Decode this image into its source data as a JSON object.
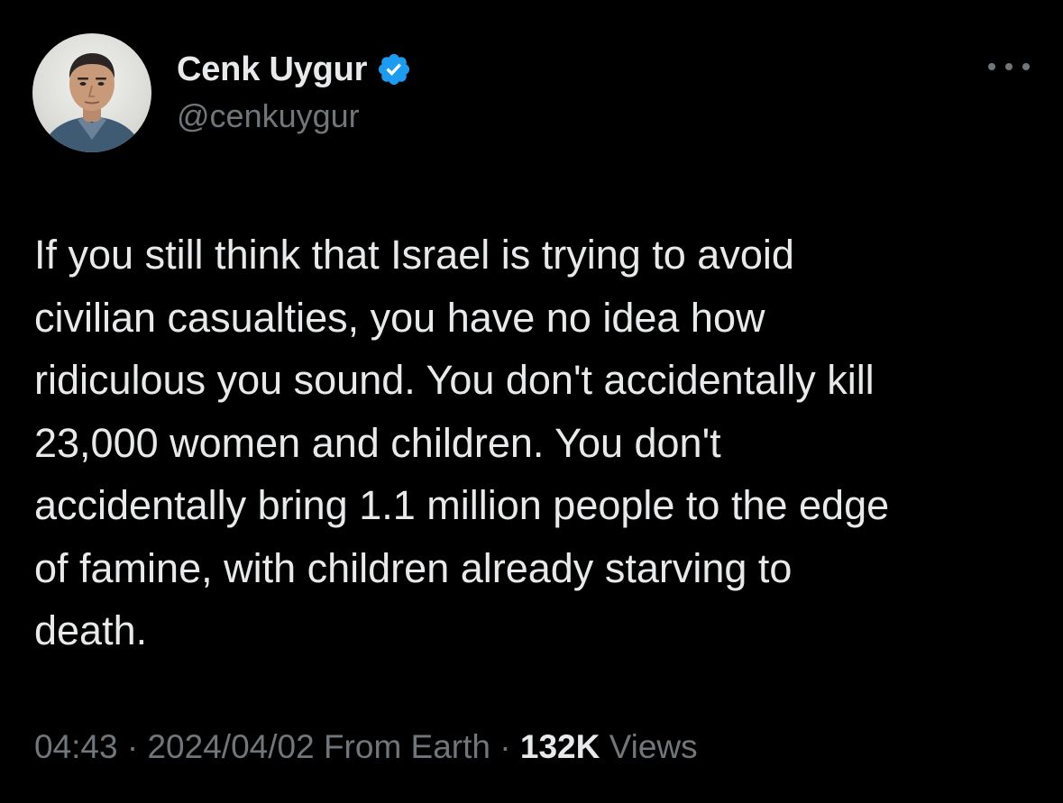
{
  "author": {
    "display_name": "Cenk Uygur",
    "handle": "@cenkuygur",
    "verified": true,
    "verified_color": "#1d9bf0"
  },
  "tweet": {
    "lines": [
      "If you still think that Israel is trying to avoid",
      "civilian casualties, you have no idea how",
      "ridiculous you sound. You don't accidentally kill",
      "23,000 women and children. You don't",
      "accidentally bring 1.1 million people to the edge",
      "of famine, with children already starving to",
      "death."
    ]
  },
  "meta": {
    "time": "04:43",
    "separator": "·",
    "date": "2024/04/02",
    "source": "From Earth",
    "views_count": "132K",
    "views_label": "Views"
  },
  "icons": {
    "more": "more-options-icon",
    "verified": "verified-badge-icon"
  },
  "colors": {
    "background": "#000000",
    "primary_text": "#e7e9ea",
    "secondary_text": "#71767b"
  }
}
